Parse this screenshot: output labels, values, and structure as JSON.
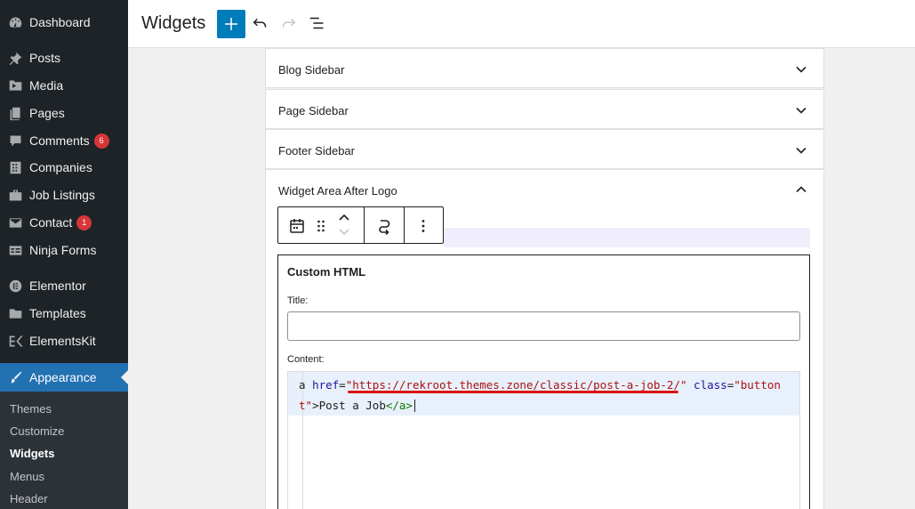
{
  "sidebar": {
    "items": [
      {
        "label": "Dashboard",
        "icon": "dashboard-icon"
      },
      {
        "label": "Posts",
        "icon": "pin-icon"
      },
      {
        "label": "Media",
        "icon": "media-icon"
      },
      {
        "label": "Pages",
        "icon": "pages-icon"
      },
      {
        "label": "Comments",
        "icon": "comment-icon",
        "badge": "6"
      },
      {
        "label": "Companies",
        "icon": "building-icon"
      },
      {
        "label": "Job Listings",
        "icon": "briefcase-icon"
      },
      {
        "label": "Contact",
        "icon": "mail-icon",
        "badge": "1"
      },
      {
        "label": "Ninja Forms",
        "icon": "form-icon"
      },
      {
        "label": "Elementor",
        "icon": "elementor-icon"
      },
      {
        "label": "Templates",
        "icon": "folder-icon"
      },
      {
        "label": "ElementsKit",
        "icon": "ek-icon"
      },
      {
        "label": "Appearance",
        "icon": "brush-icon"
      }
    ],
    "submenu": [
      "Themes",
      "Customize",
      "Widgets",
      "Menus",
      "Header"
    ]
  },
  "header": {
    "title": "Widgets"
  },
  "areas": [
    {
      "label": "Blog Sidebar"
    },
    {
      "label": "Page Sidebar"
    },
    {
      "label": "Footer Sidebar"
    },
    {
      "label": "Widget Area After Logo"
    }
  ],
  "widget": {
    "heading": "Custom HTML",
    "title_label": "Title:",
    "title_value": "",
    "content_label": "Content:",
    "code": {
      "l1_prefix": "a ",
      "l1_attr": "href",
      "l1_eq": "=",
      "l1_url": "\"https://rekroot.themes.zone/classic/post-a-job-2/\"",
      "l1_attr2": "class",
      "l1_eq2": "=",
      "l1_str2": "\"button",
      "l2_prefix": "t\"",
      "l2_text": ">Post a Job",
      "l2_close": "</a>"
    }
  },
  "colors": {
    "sidebar_bg": "#1d2327",
    "accent": "#2271b1",
    "add_button": "#007cba",
    "badge": "#d63638"
  }
}
